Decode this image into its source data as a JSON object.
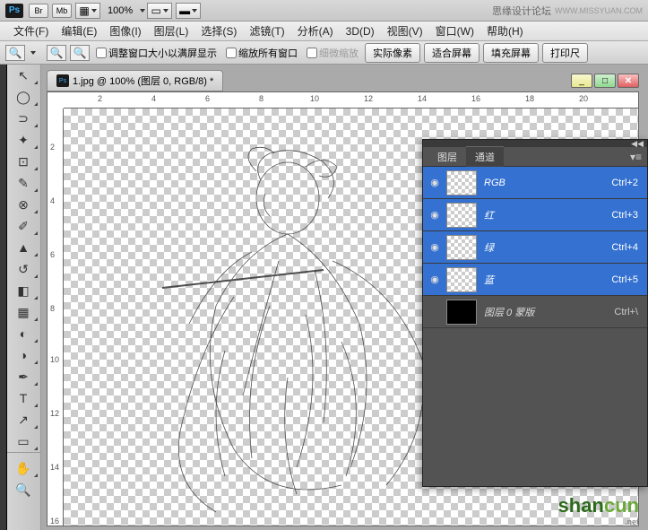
{
  "topbar": {
    "zoom": "100%",
    "brand": "思缘设计论坛",
    "brand_url": "WWW.MISSYUAN.COM"
  },
  "menu": [
    "文件(F)",
    "编辑(E)",
    "图像(I)",
    "图层(L)",
    "选择(S)",
    "滤镜(T)",
    "分析(A)",
    "3D(D)",
    "视图(V)",
    "窗口(W)",
    "帮助(H)"
  ],
  "options": {
    "chk1": "调整窗口大小以满屏显示",
    "chk2": "缩放所有窗口",
    "chk3": "细微缩放",
    "btn1": "实际像素",
    "btn2": "适合屏幕",
    "btn3": "填充屏幕",
    "btn4": "打印尺"
  },
  "tab": {
    "title": "1.jpg @ 100% (图层 0, RGB/8) *"
  },
  "ruler_h": [
    "2",
    "4",
    "6",
    "8",
    "10",
    "12",
    "14",
    "16",
    "18",
    "20"
  ],
  "ruler_v": [
    "2",
    "4",
    "6",
    "8",
    "10",
    "12",
    "14",
    "16"
  ],
  "panel": {
    "tab_layers": "图层",
    "tab_channels": "通道",
    "channels": [
      {
        "name": "RGB",
        "short": "Ctrl+2",
        "sel": true,
        "eye": true
      },
      {
        "name": "红",
        "short": "Ctrl+3",
        "sel": true,
        "eye": true
      },
      {
        "name": "绿",
        "short": "Ctrl+4",
        "sel": true,
        "eye": true
      },
      {
        "name": "蓝",
        "short": "Ctrl+5",
        "sel": true,
        "eye": true
      },
      {
        "name": "图层 0 蒙版",
        "short": "Ctrl+\\",
        "sel": false,
        "eye": false
      }
    ]
  },
  "watermark": {
    "t1": "shan",
    "t2": "cun",
    "sub": ".net"
  }
}
